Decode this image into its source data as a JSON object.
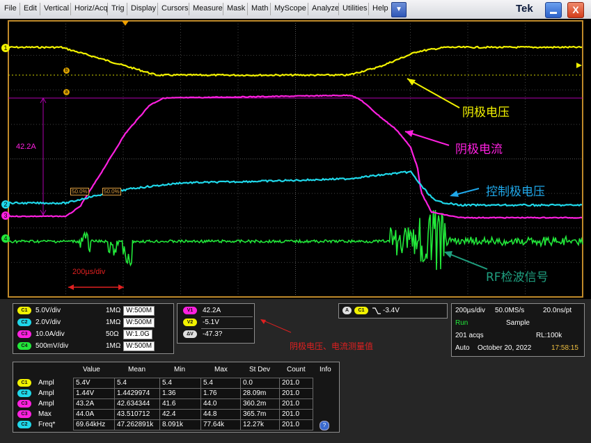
{
  "menu": {
    "items": [
      "File",
      "Edit",
      "Vertical",
      "Horiz/Acq",
      "Trig",
      "Display",
      "Cursors",
      "Measure",
      "Mask",
      "Math",
      "MyScope",
      "Analyze",
      "Utilities",
      "Help"
    ],
    "dropdown_glyph": "▼",
    "brand": "Tek",
    "close_glyph": "X"
  },
  "colors": {
    "ch1": "#f2f200",
    "ch2": "#1fd8ea",
    "ch3": "#ff20e0",
    "ch4": "#22e83a",
    "frame": "#c08a2a",
    "annot_red": "#e02020"
  },
  "scope": {
    "markers": {
      "ch1": "1",
      "ch2": "2",
      "ch3": "3",
      "ch4": "4",
      "ref_b": "b",
      "ref_a": "a"
    },
    "cursor_label": "42.2A",
    "crossing_labels": [
      "50.0%",
      "50.0%"
    ],
    "timebase_label": "200µs/div",
    "annotations": {
      "cathode_voltage": "阴极电压",
      "cathode_current": "阴极电流",
      "grid_voltage": "控制极电压",
      "rf_signal": "RF检波信号"
    }
  },
  "channels": [
    {
      "badge": "C1",
      "scale": "5.0V/div",
      "impedance": "1MΩ",
      "bw": "W:500M"
    },
    {
      "badge": "C2",
      "scale": "2.0V/div",
      "impedance": "1MΩ",
      "bw": "W:500M"
    },
    {
      "badge": "C3",
      "scale": "10.0A/div",
      "impedance": "50Ω",
      "bw": "W:1.0G"
    },
    {
      "badge": "C4",
      "scale": "500mV/div",
      "impedance": "1MΩ",
      "bw": "W:500M"
    }
  ],
  "cursors": [
    {
      "badge": "V1",
      "value": "42.2A"
    },
    {
      "badge": "V2",
      "value": "-5.1V"
    },
    {
      "badge": "ΔV",
      "value": "-47.3?"
    }
  ],
  "cursor_note": "阴极电压、电流测量值",
  "trigger": {
    "badge_a": "A",
    "badge_ch": "C1",
    "level": "-3.4V"
  },
  "acq": {
    "timebase": "200µs/div",
    "sample_rate": "50.0MS/s",
    "resolution": "20.0ns/pt",
    "state": "Run",
    "mode": "Sample",
    "acqs": "201 acqs",
    "rl": "RL:100k",
    "trigger_mode": "Auto",
    "date": "October 20, 2022",
    "time": "17:58:15"
  },
  "measurements": {
    "headers": [
      "Value",
      "Mean",
      "Min",
      "Max",
      "St Dev",
      "Count",
      "Info"
    ],
    "rows": [
      {
        "badge": "C1",
        "badge_color": "#f2f200",
        "name": "Ampl",
        "value": "5.4V",
        "mean": "5.4",
        "min": "5.4",
        "max": "5.4",
        "stdev": "0.0",
        "count": "201.0"
      },
      {
        "badge": "C2",
        "badge_color": "#1fd8ea",
        "name": "Ampl",
        "value": "1.44V",
        "mean": "1.4429974",
        "min": "1.36",
        "max": "1.76",
        "stdev": "28.09m",
        "count": "201.0"
      },
      {
        "badge": "C3",
        "badge_color": "#ff20e0",
        "name": "Ampl",
        "value": "43.2A",
        "mean": "42.634344",
        "min": "41.6",
        "max": "44.0",
        "stdev": "360.2m",
        "count": "201.0"
      },
      {
        "badge": "C3",
        "badge_color": "#ff20e0",
        "name": "Max",
        "value": "44.0A",
        "mean": "43.510712",
        "min": "42.4",
        "max": "44.8",
        "stdev": "365.7m",
        "count": "201.0"
      },
      {
        "badge": "C2",
        "badge_color": "#1fd8ea",
        "name": "Freq*",
        "value": "69.64kHz",
        "mean": "47.262891k",
        "min": "8.091k",
        "max": "77.64k",
        "stdev": "12.27k",
        "count": "201.0"
      }
    ]
  }
}
